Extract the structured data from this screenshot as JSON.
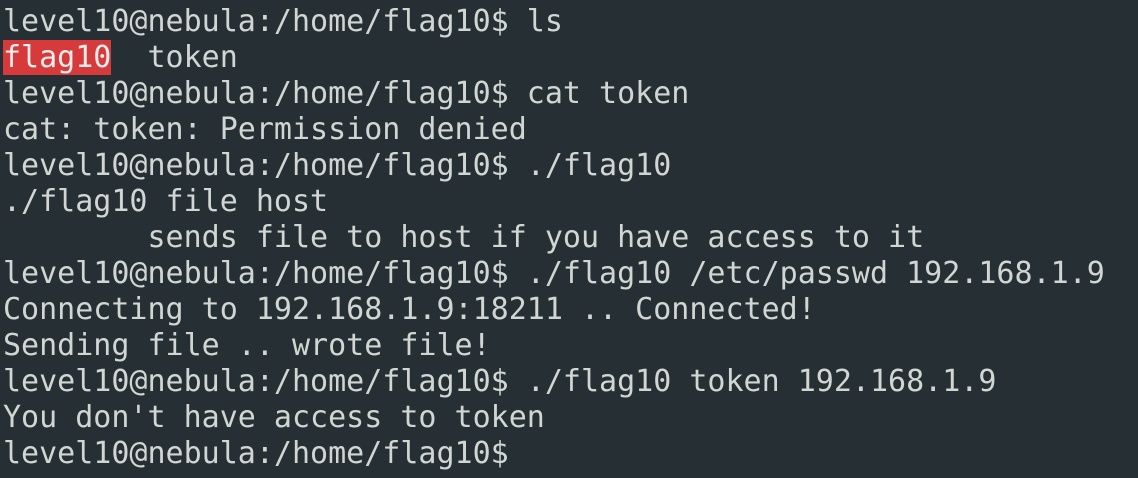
{
  "colors": {
    "background": "#263034",
    "foreground": "#d2d6d3",
    "executable_highlight": "#d73a3a"
  },
  "terminal": {
    "lines": [
      {
        "prompt": "level10@nebula:/home/flag10$",
        "command": " ls"
      },
      {
        "executable": "flag10",
        "rest": "  token"
      },
      {
        "prompt": "level10@nebula:/home/flag10$",
        "command": " cat token"
      },
      {
        "text": "cat: token: Permission denied"
      },
      {
        "prompt": "level10@nebula:/home/flag10$",
        "command": " ./flag10"
      },
      {
        "text": "./flag10 file host"
      },
      {
        "text": "        sends file to host if you have access to it"
      },
      {
        "prompt": "level10@nebula:/home/flag10$",
        "command": " ./flag10 /etc/passwd 192.168.1.9"
      },
      {
        "text": "Connecting to 192.168.1.9:18211 .. Connected!"
      },
      {
        "text": "Sending file .. wrote file!"
      },
      {
        "prompt": "level10@nebula:/home/flag10$",
        "command": " ./flag10 token 192.168.1.9"
      },
      {
        "text": "You don't have access to token"
      },
      {
        "prompt": "level10@nebula:/home/flag10$",
        "command": ""
      }
    ]
  }
}
